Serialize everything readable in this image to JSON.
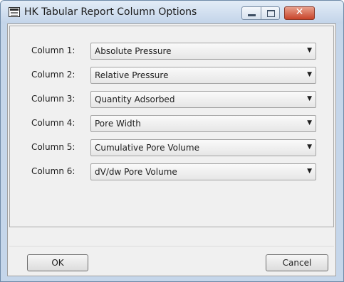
{
  "window": {
    "title": "HK Tabular Report Column Options",
    "controls": [
      "minimize",
      "maximize",
      "close"
    ],
    "close_glyph": "✕"
  },
  "columns": [
    {
      "label": "Column 1:",
      "value": "Absolute Pressure"
    },
    {
      "label": "Column 2:",
      "value": "Relative Pressure"
    },
    {
      "label": "Column 3:",
      "value": "Quantity Adsorbed"
    },
    {
      "label": "Column 4:",
      "value": "Pore Width"
    },
    {
      "label": "Column 5:",
      "value": "Cumulative Pore Volume"
    },
    {
      "label": "Column 6:",
      "value": "dV/dw Pore Volume"
    }
  ],
  "combo_arrow": "▼",
  "buttons": {
    "ok": "OK",
    "cancel": "Cancel"
  },
  "colors": {
    "titlebar": "#c3d4e9",
    "close_button": "#c8442a",
    "dialog_bg": "#f0f0f0"
  }
}
